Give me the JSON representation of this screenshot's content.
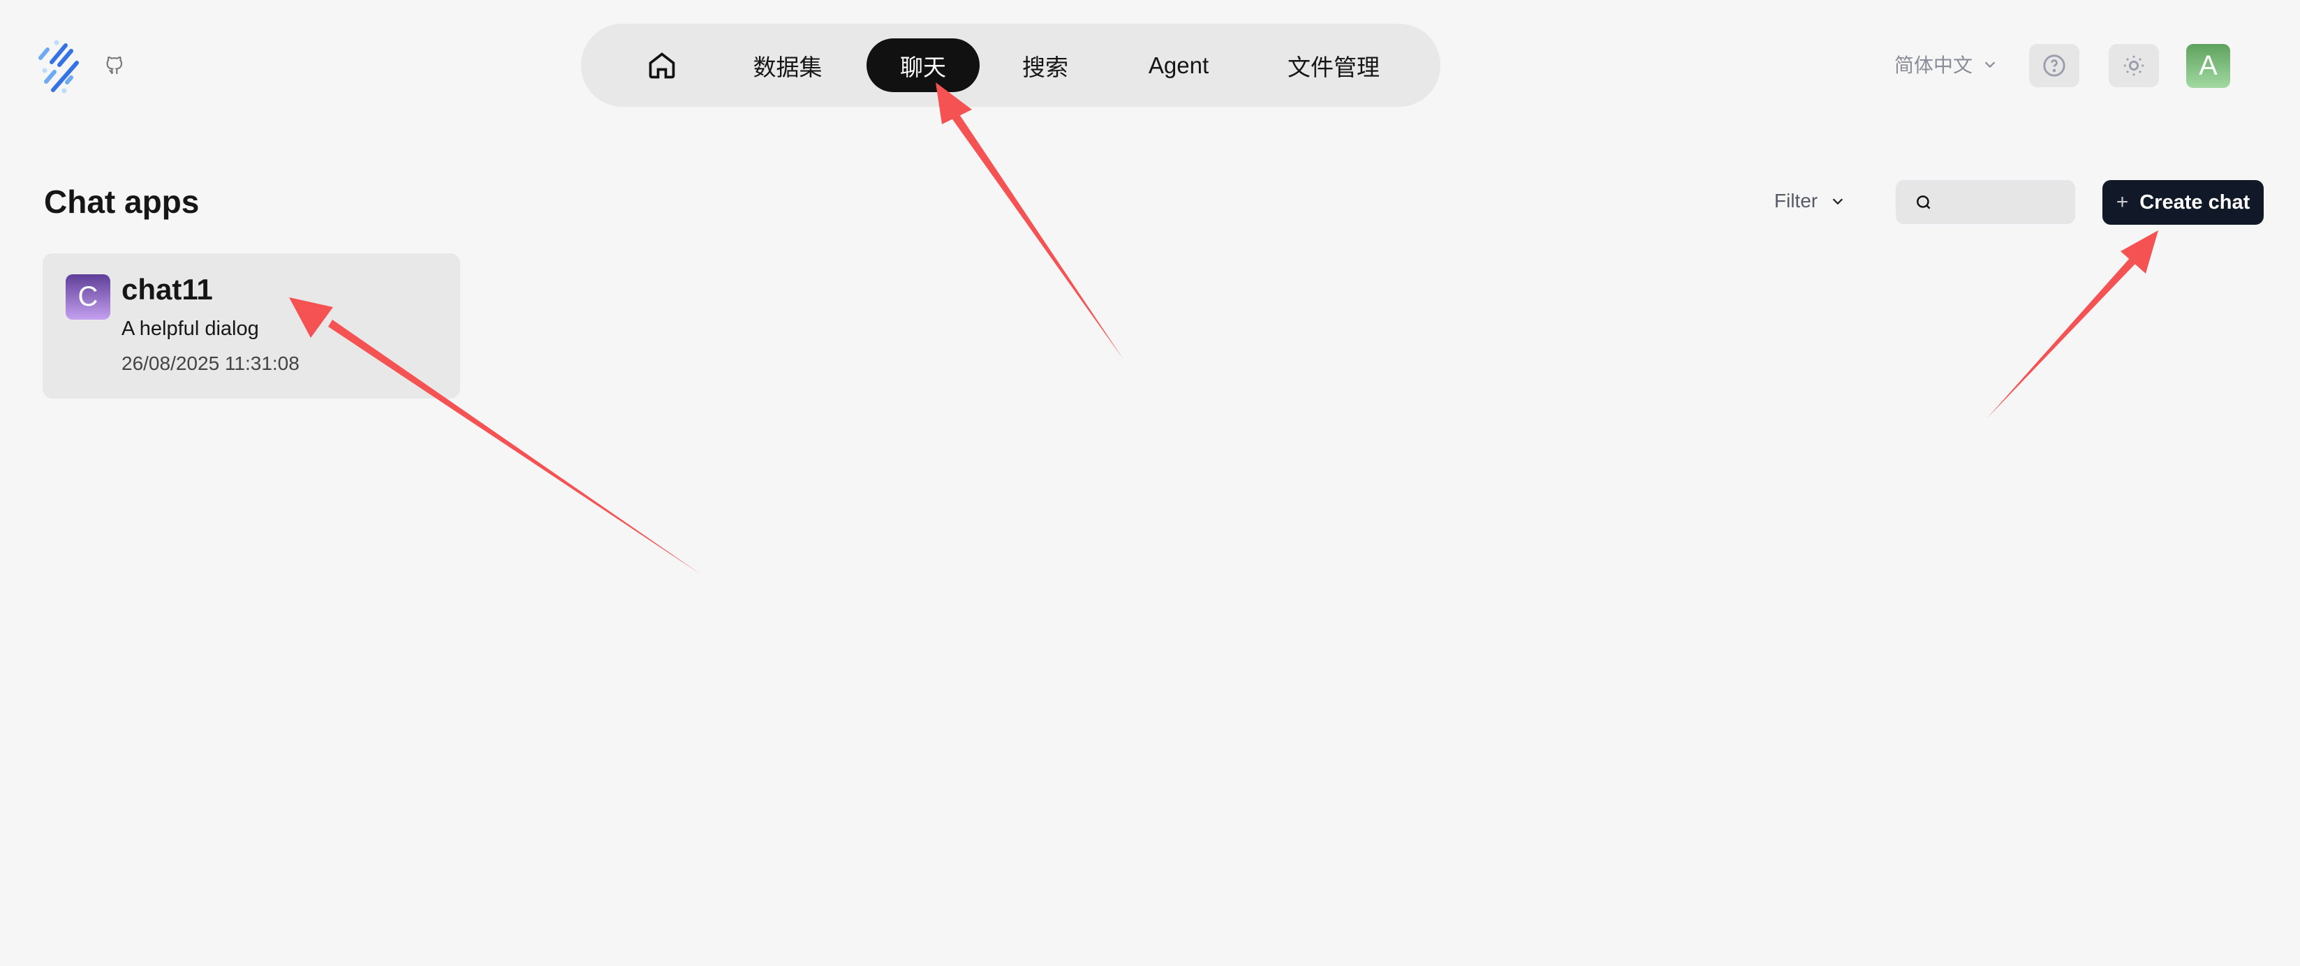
{
  "nav": {
    "items": [
      {
        "label": "数据集"
      },
      {
        "label": "聊天"
      },
      {
        "label": "搜索"
      },
      {
        "label": "Agent"
      },
      {
        "label": "文件管理"
      }
    ],
    "active": "聊天"
  },
  "header": {
    "language": "简体中文",
    "avatar_initial": "A"
  },
  "page": {
    "title": "Chat apps",
    "filter_label": "Filter",
    "search_placeholder": "",
    "create_label": "Create chat"
  },
  "apps": [
    {
      "initial": "C",
      "name": "chat11",
      "description": "A helpful dialog",
      "date": "26/08/2025 11:31:08"
    }
  ],
  "colors": {
    "accent": "#111827",
    "annotation": "#f55353"
  }
}
